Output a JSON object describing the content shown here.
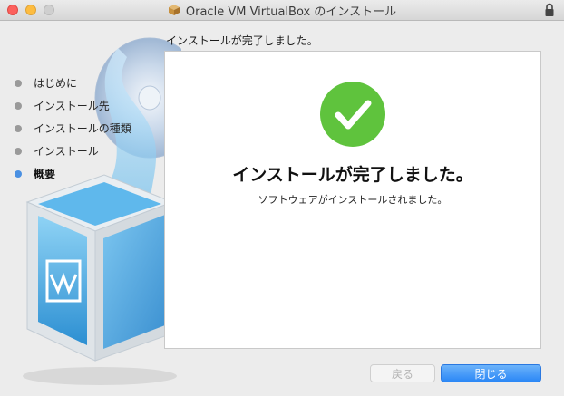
{
  "window": {
    "title": "Oracle VM VirtualBox のインストール"
  },
  "header": {
    "text": "インストールが完了しました。"
  },
  "sidebar": {
    "items": [
      {
        "label": "はじめに"
      },
      {
        "label": "インストール先"
      },
      {
        "label": "インストールの種類"
      },
      {
        "label": "インストール"
      },
      {
        "label": "概要"
      }
    ],
    "active_index": 4
  },
  "panel": {
    "headline": "インストールが完了しました。",
    "subline": "ソフトウェアがインストールされました。"
  },
  "buttons": {
    "back_label": "戻る",
    "close_label": "閉じる"
  },
  "colors": {
    "success": "#5fc33d",
    "accent": "#2b87f6",
    "active_dot": "#4a90e2"
  },
  "icons": {
    "title": "installer-package-icon",
    "lock": "lock-icon",
    "status": "checkmark-icon"
  }
}
